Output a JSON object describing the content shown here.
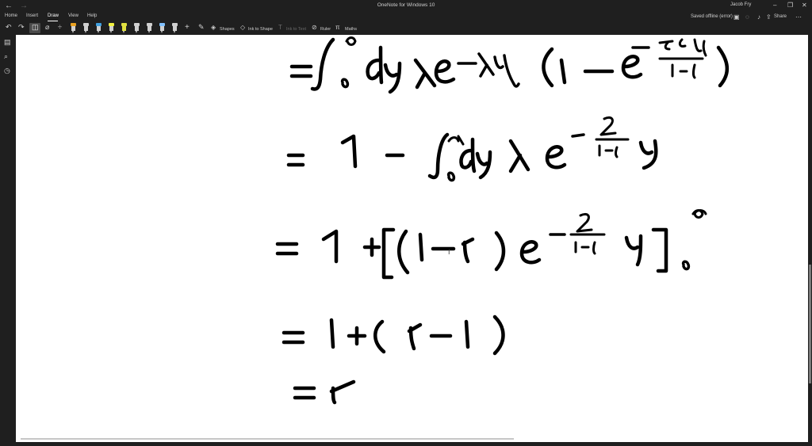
{
  "window": {
    "title": "OneNote for Windows 10",
    "user": "Jacob Fry",
    "back_glyph": "←",
    "forward_glyph": "→"
  },
  "ribbon": {
    "tabs": [
      "Home",
      "Insert",
      "Draw",
      "View",
      "Help"
    ],
    "active_tab": "Draw",
    "status": "Saved offline (error)",
    "share_label": "Share"
  },
  "toolbar": {
    "shapes_label": "Shapes",
    "ink_to_shape_label": "Ink to Shape",
    "ink_to_text_label": "Ink to Text",
    "ruler_label": "Ruler",
    "maths_label": "Maths",
    "pen_colors": [
      "#e8a020",
      "#d0d0d0",
      "#40a0e0",
      "#f0f040",
      "#e0e040",
      "#d0d0d0",
      "#d0d0d0",
      "#80c0ff",
      "#d0d0d0",
      "#d0d0d0"
    ]
  },
  "colors": {
    "chrome": "#1f1f1f",
    "canvas": "#ffffff",
    "ink": "#000000"
  }
}
